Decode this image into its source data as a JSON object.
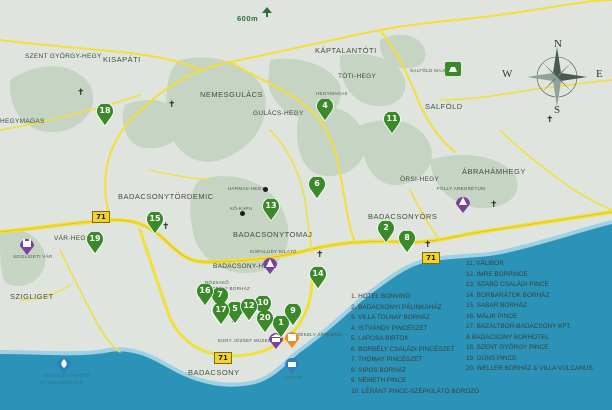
{
  "colors": {
    "land": "#dfe5de",
    "forest": "#bfd0bd",
    "lake": "#2b93b8",
    "lake_light": "#9fd0e3",
    "road": "#f3df3a",
    "pin": "#3a8a2a",
    "poi_purple": "#7b3f9e",
    "poi_blue": "#2d7fbe",
    "poi_orange": "#f08a1c"
  },
  "elevation": {
    "label": "600m",
    "icon": "arrow-up-icon"
  },
  "towns": [
    {
      "key": "kisapati",
      "label": "KISAPÁTI"
    },
    {
      "key": "nemesgulacs",
      "label": "NEMESGULÁCS"
    },
    {
      "key": "kaptalantoti",
      "label": "KÁPTALANTÓTI"
    },
    {
      "key": "salfold",
      "label": "SALFÖLD"
    },
    {
      "key": "abrahamhegy",
      "label": "ÁBRAHÁMHEGY"
    },
    {
      "key": "badacsonytordemic",
      "label": "BADACSONYTÖRDEMIC"
    },
    {
      "key": "badacsonytomaj",
      "label": "BADACSONYTOMAJ"
    },
    {
      "key": "badacsonyors",
      "label": "BADACSONYÖRS"
    },
    {
      "key": "szigliget",
      "label": "SZIGLIGET"
    },
    {
      "key": "badacsony",
      "label": "BADACSONY"
    }
  ],
  "hills": [
    {
      "key": "szent-gyorgy-hegy",
      "label": "SZENT GYÖRGY-HEGY"
    },
    {
      "key": "hegymagas",
      "label": "HEGYMAGAS"
    },
    {
      "key": "toti-hegy",
      "label": "TÓTI-HEGY"
    },
    {
      "key": "gulacs-hegy",
      "label": "GULÁCS-HEGY"
    },
    {
      "key": "orsi-hegy",
      "label": "ÖRSI-HEGY"
    },
    {
      "key": "var-hegy",
      "label": "VÁR-HEGY"
    },
    {
      "key": "badacsony-hegy",
      "label": "BADACSONY-HEGY"
    }
  ],
  "small_labels": [
    {
      "key": "hegymagas-small",
      "label": "HEGYMAGAS"
    },
    {
      "key": "salfold-major",
      "label": "SALFÖLD MAJOR"
    },
    {
      "key": "kilato",
      "label": "KŐ-KAPU"
    },
    {
      "key": "ramaz-hegy",
      "label": "HÁRMAS-HEGY"
    },
    {
      "key": "kisfaludy",
      "label": "KISFALUDY KILÁTÓ"
    },
    {
      "key": "szigliget-var",
      "label": "SZIGLIGETI VÁR"
    },
    {
      "key": "folly-arboretum",
      "label": "FOLLY ARBORÉTUM"
    },
    {
      "key": "rodostei",
      "label": "RÓZSAKŐ"
    },
    {
      "key": "borharaz",
      "label": "BORBÉLY BORHÁZ"
    },
    {
      "key": "egry-muzeum",
      "label": "EGRY JÓZSEF MÚZEUM"
    },
    {
      "key": "kisfaludy-haz",
      "label": "SZÉKELY ÁRTEMISZ"
    },
    {
      "key": "szigeti-kikoto",
      "label": "SZIGLIGETI KIKÖTŐ"
    },
    {
      "key": "kikoto",
      "label": "KIKÖTŐ"
    },
    {
      "key": "vitorlasar",
      "label": "VITORLÁSKIKÖTŐ"
    }
  ],
  "roads": [
    {
      "key": "road-71-a",
      "label": "71"
    },
    {
      "key": "road-71-b",
      "label": "71"
    },
    {
      "key": "road-71-c",
      "label": "71"
    }
  ],
  "compass": {
    "n": "N",
    "e": "E",
    "s": "S",
    "w": "W"
  },
  "pins": [
    {
      "num": "1"
    },
    {
      "num": "2"
    },
    {
      "num": "3"
    },
    {
      "num": "4"
    },
    {
      "num": "5"
    },
    {
      "num": "6"
    },
    {
      "num": "7"
    },
    {
      "num": "8"
    },
    {
      "num": "9"
    },
    {
      "num": "10"
    },
    {
      "num": "11"
    },
    {
      "num": "12"
    },
    {
      "num": "13"
    },
    {
      "num": "14"
    },
    {
      "num": "15"
    },
    {
      "num": "16"
    },
    {
      "num": "17"
    },
    {
      "num": "18"
    },
    {
      "num": "19"
    },
    {
      "num": "20"
    }
  ],
  "legend_left": [
    "1.  HOTEL BONVINO",
    "2.  BADACSONYI PÁLINKAHÁZ",
    "3.  VILLA TOLNAY BORHÁZ",
    "4.  ISTVÁNDY PINCÉSZET",
    "5.  LAPOSA BIRTOK",
    "6.  BORBÉLY CSALÁDI PINCÉSZET",
    "7.  THOMAY PINCÉSZET",
    "8.  SIPOS BORHÁZ",
    "9.  NÉMETH PINCE",
    "10. LÉRÁNT PINCE-SZÉPKILÁTÓ BOROZÓ"
  ],
  "legend_right": [
    "11. VÁLIBOR",
    "12. IMRE BORPINCE",
    "13. SZABÓ CSALÁDI PINCE",
    "14. BORBARÁTOK BORHÁZ",
    "15. SABAR  BORHÁZ",
    "16. MÁLIK PINCE",
    "17. BAZALTBOR-BADACSONY KFT.",
    "     & BADACSONY BORHOTEL",
    "18. SZENT GYÖRGY PINCE",
    "19. GÜNS PINCE",
    "20. WELLER BORHÁZ & VILLA VULCANUS"
  ]
}
